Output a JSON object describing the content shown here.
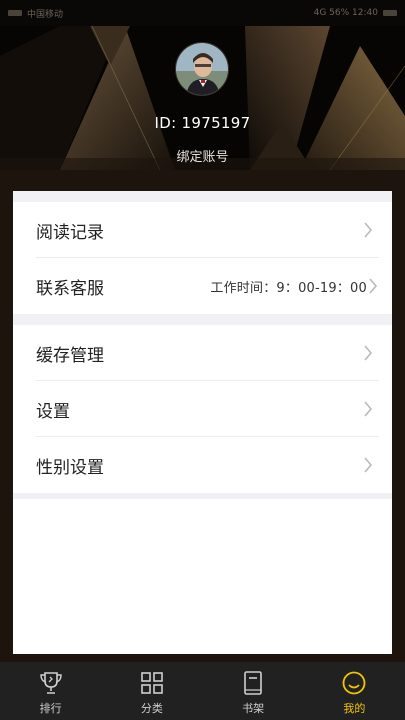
{
  "status_bar": {
    "left_text": "中国移动",
    "right_text": "4G 56% 12:40"
  },
  "profile": {
    "id_text": "ID: 1975197",
    "bind_label": "绑定账号"
  },
  "menu_groups": [
    [
      {
        "label": "阅读记录",
        "aside": ""
      },
      {
        "label": "联系客服",
        "aside": "工作时间：9：00-19：00"
      }
    ],
    [
      {
        "label": "缓存管理",
        "aside": ""
      },
      {
        "label": "设置",
        "aside": ""
      },
      {
        "label": "性别设置",
        "aside": ""
      }
    ]
  ],
  "tab_bar": {
    "tabs": [
      {
        "label": "排行",
        "icon": "trophy-icon",
        "active": false
      },
      {
        "label": "分类",
        "icon": "grid-icon",
        "active": false
      },
      {
        "label": "书架",
        "icon": "book-icon",
        "active": false
      },
      {
        "label": "我的",
        "icon": "smile-icon",
        "active": true
      }
    ],
    "active_color": "#f2c500",
    "inactive_color": "#cfcfcf"
  },
  "colors": {
    "header_bg": "#070504",
    "accent_gold": "#8a6a3c",
    "tab_bar_bg": "#212121"
  }
}
